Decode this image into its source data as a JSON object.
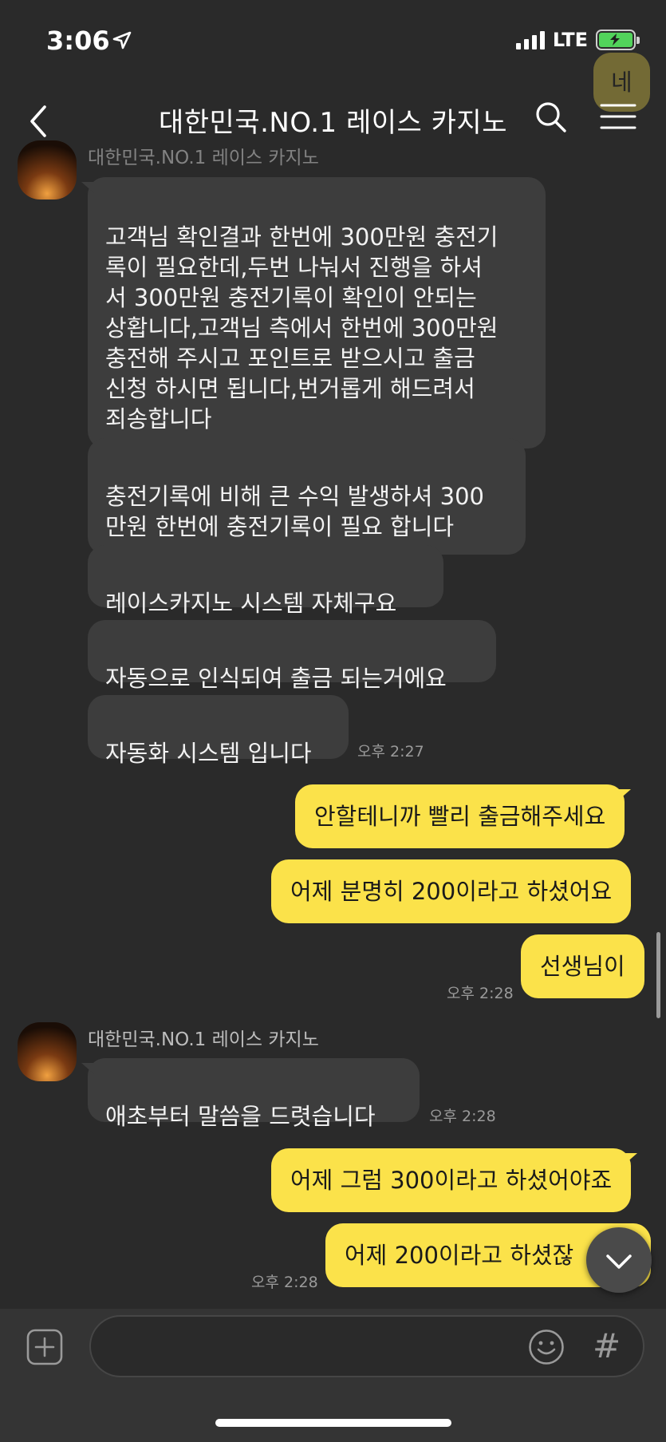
{
  "status_bar": {
    "time": "3:06",
    "network": "LTE"
  },
  "header": {
    "title": "대한민국.NO.1 레이스 카지노",
    "back_icon": "chevron-left-icon",
    "search_icon": "search-icon",
    "menu_icon": "hamburger-menu-icon"
  },
  "top_partial": {
    "bubble_text": "네",
    "sender": "대한민국.NO.1 레이스 카지노"
  },
  "messages_group_1": [
    {
      "text": "고객님 확인결과 한번에 300만원 충전기\n록이 필요한데,두번 나눠서 진행을 하셔\n서 300만원 충전기록이 확인이 안되는\n상홥니다,고객님 측에서 한번에 300만원\n충전해 주시고 포인트로 받으시고 출금\n신청 하시면 됩니다,번거롭게 해드려서\n죄송합니다"
    },
    {
      "text": "충전기록에 비해 큰 수익 발생하셔 300\n만원 한번에 충전기록이 필요 합니다"
    },
    {
      "text": "레이스카지노 시스템 자체구요"
    },
    {
      "text": "자동으로 인식되여 출금 되는거에요"
    },
    {
      "text": "자동화 시스템 입니다"
    }
  ],
  "time_1": "오후 2:27",
  "my_messages_1": [
    {
      "text": "안할테니까 빨리 출금해주세요"
    },
    {
      "text": "어제 분명히 200이라고 하셨어요"
    },
    {
      "text": "선생님이"
    }
  ],
  "time_2": "오후 2:28",
  "sender_2": "대한민국.NO.1 레이스 카지노",
  "messages_group_2": [
    {
      "text": "애초부터 말씀을 드렷습니다"
    }
  ],
  "time_3": "오후 2:28",
  "my_messages_2": [
    {
      "text": "어제 그럼 300이라고 하셨어야죠"
    },
    {
      "text": "어제 200이라고 하셨잖"
    }
  ],
  "time_4": "오후 2:28",
  "input_bar": {
    "placeholder": "",
    "hash_label": "#"
  }
}
